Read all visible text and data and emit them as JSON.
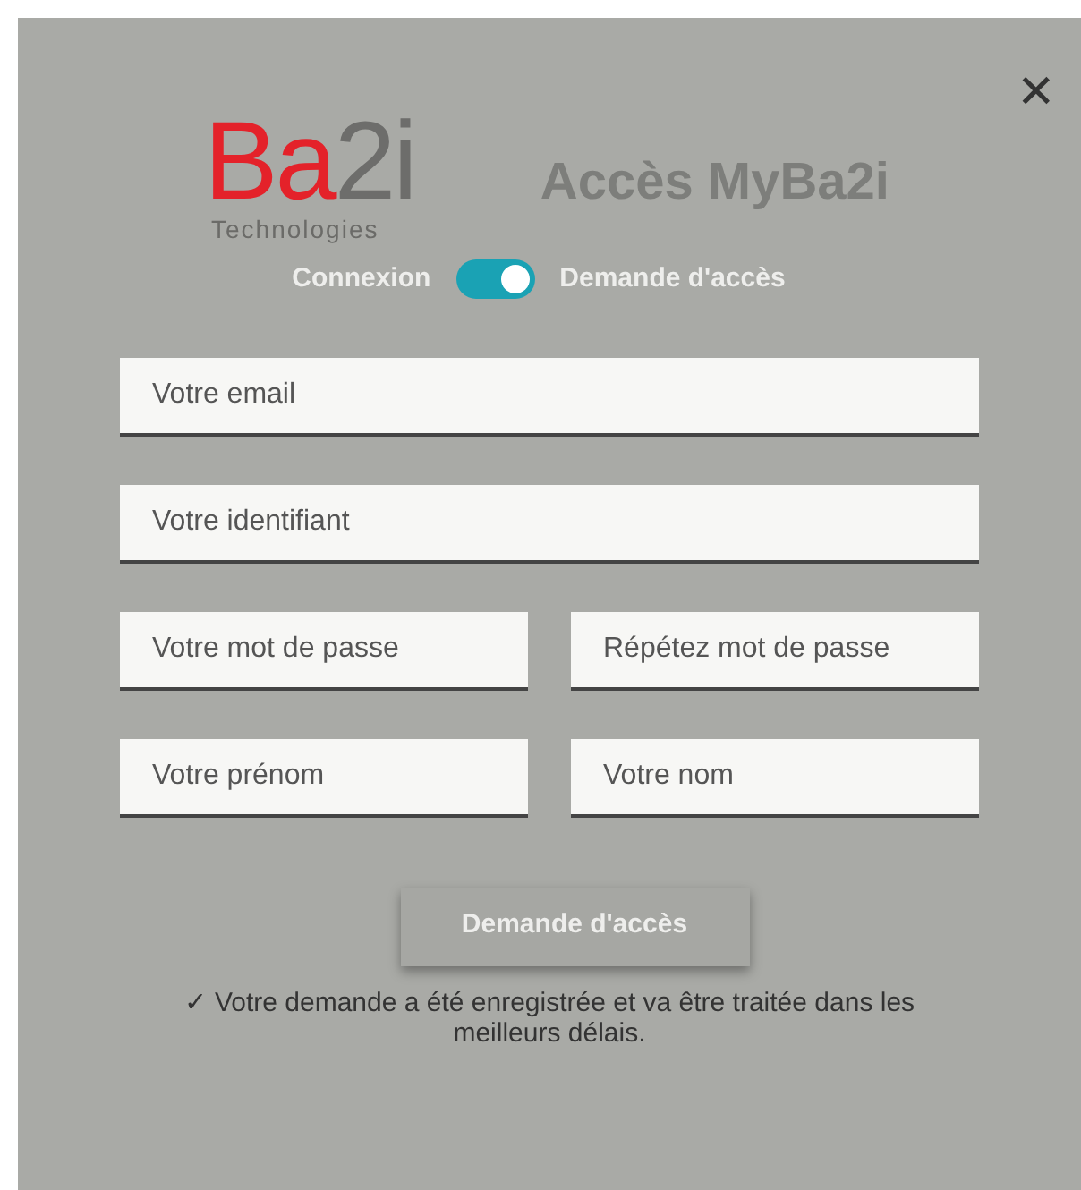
{
  "close": {
    "label": "✕"
  },
  "logo": {
    "part_1": "Ba",
    "part_2": "2i",
    "subtitle": "Technologies"
  },
  "title": "Accès MyBa2i",
  "mode_switch": {
    "left_label": "Connexion",
    "right_label": "Demande d'accès",
    "on": true
  },
  "fields": [
    {
      "placeholder": "Votre email",
      "kind": "full"
    },
    {
      "placeholder": "Votre identifiant",
      "kind": "full"
    },
    {
      "placeholder": "Votre mot de passe",
      "kind": "half"
    },
    {
      "placeholder": "Répétez mot de passe",
      "kind": "half"
    },
    {
      "placeholder": "Votre prénom",
      "kind": "half"
    },
    {
      "placeholder": "Votre nom",
      "kind": "half"
    }
  ],
  "submit_button": "Demande d'accès",
  "message": {
    "icon": "✓",
    "text": "Votre demande a été enregistrée et va être traitée dans les meilleurs délais."
  }
}
